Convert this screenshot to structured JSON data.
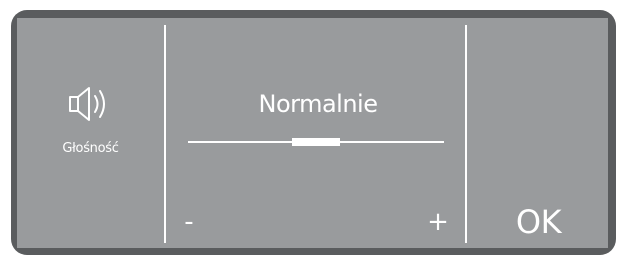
{
  "volume_setting": {
    "icon": "speaker-icon",
    "label": "Głośność"
  },
  "level": {
    "current_label": "Normalnie",
    "position_fraction": 0.5
  },
  "controls": {
    "minus_label": "-",
    "plus_label": "+",
    "ok_label": "OK"
  },
  "colors": {
    "screen": "#999b9d",
    "bezel": "#5a5c5e",
    "foreground": "#ffffff"
  }
}
